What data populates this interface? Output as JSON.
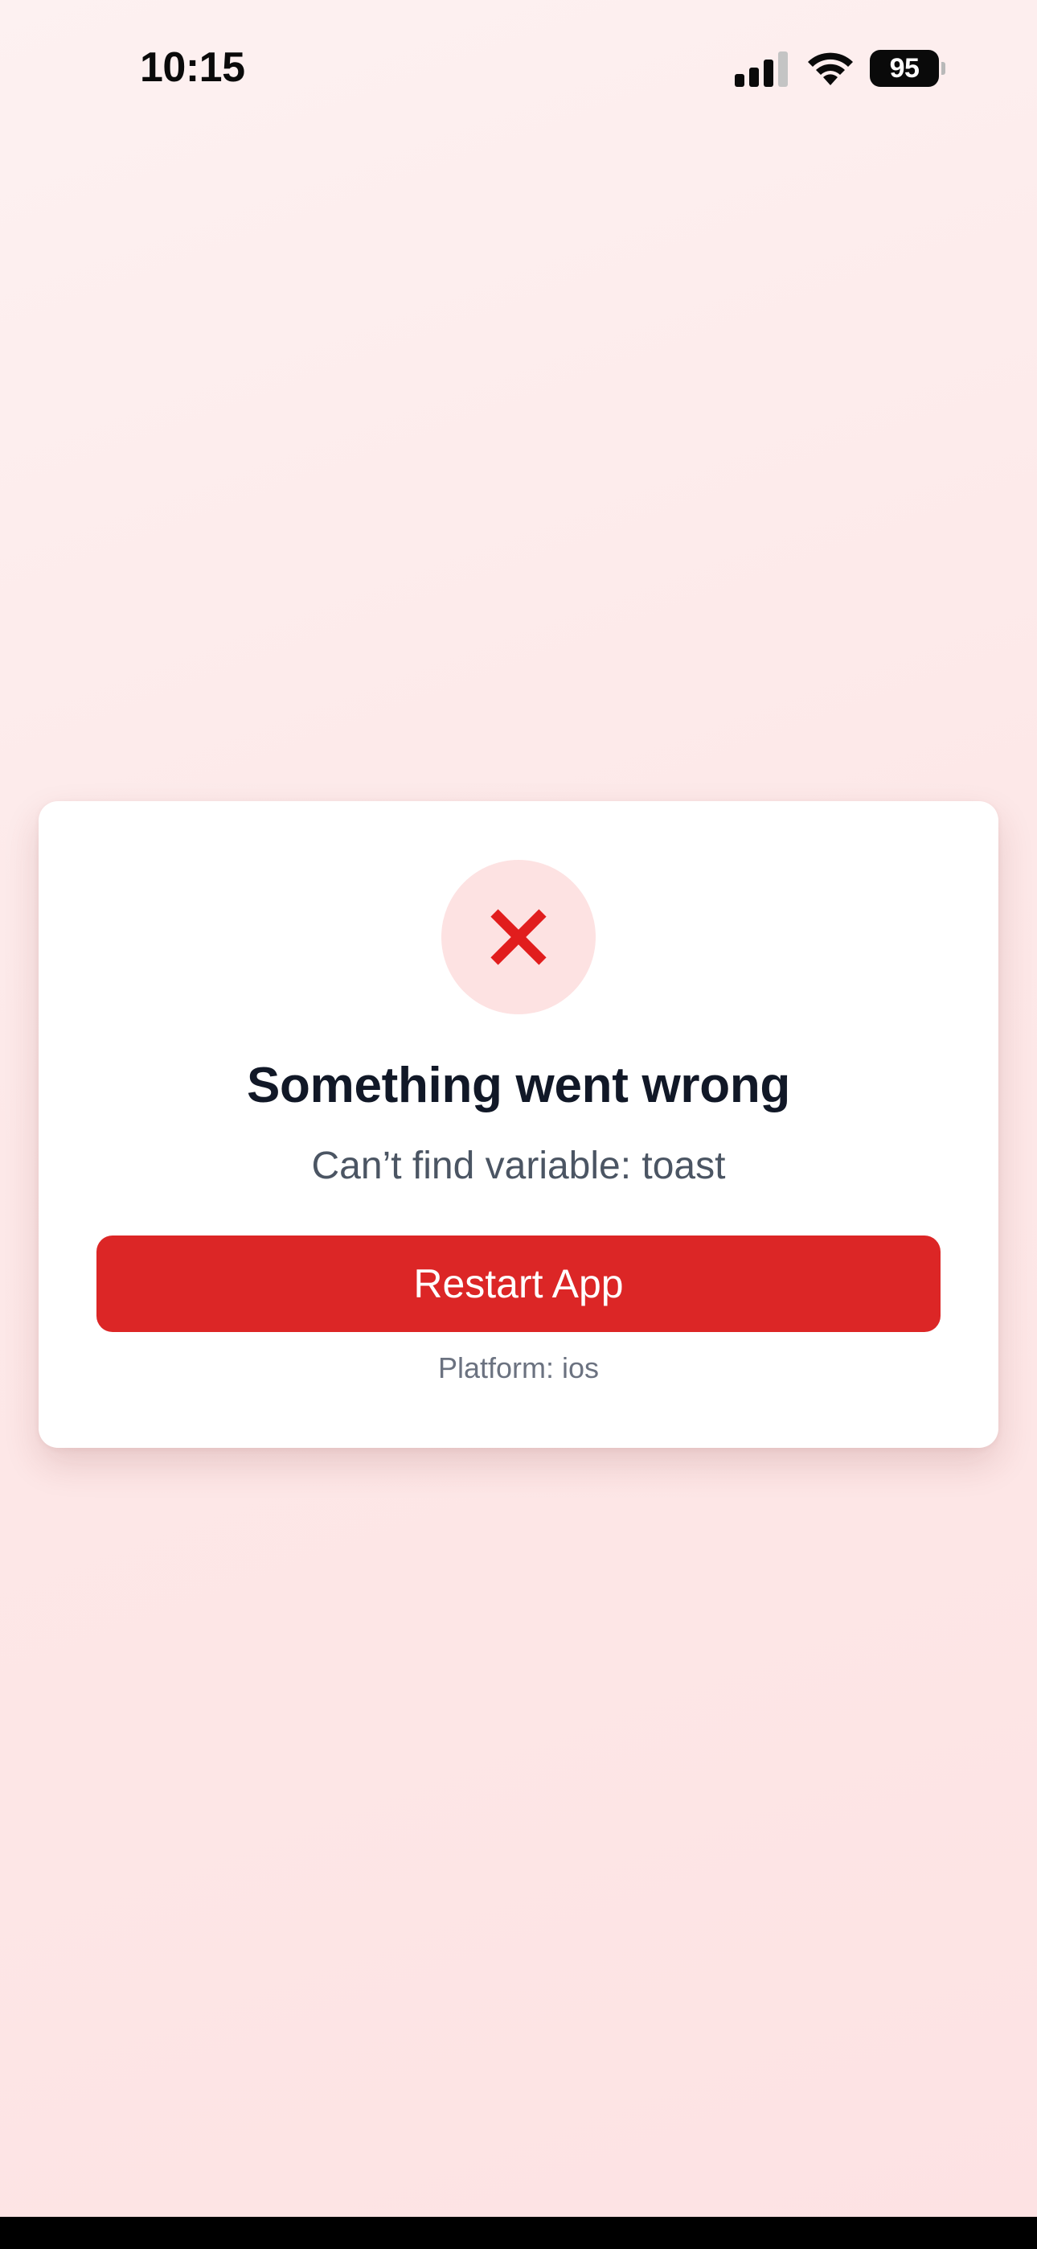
{
  "status_bar": {
    "time": "10:15",
    "battery_level": "95",
    "signal_icon": "cellular-signal-icon",
    "wifi_icon": "wifi-icon"
  },
  "error_card": {
    "icon": "close-x-icon",
    "icon_color": "#e11d1d",
    "icon_background": "#fde2e2",
    "title": "Something went wrong",
    "message": "Can’t find variable: toast",
    "button_label": "Restart App",
    "button_color": "#dc2626",
    "platform_text": "Platform: ios"
  }
}
